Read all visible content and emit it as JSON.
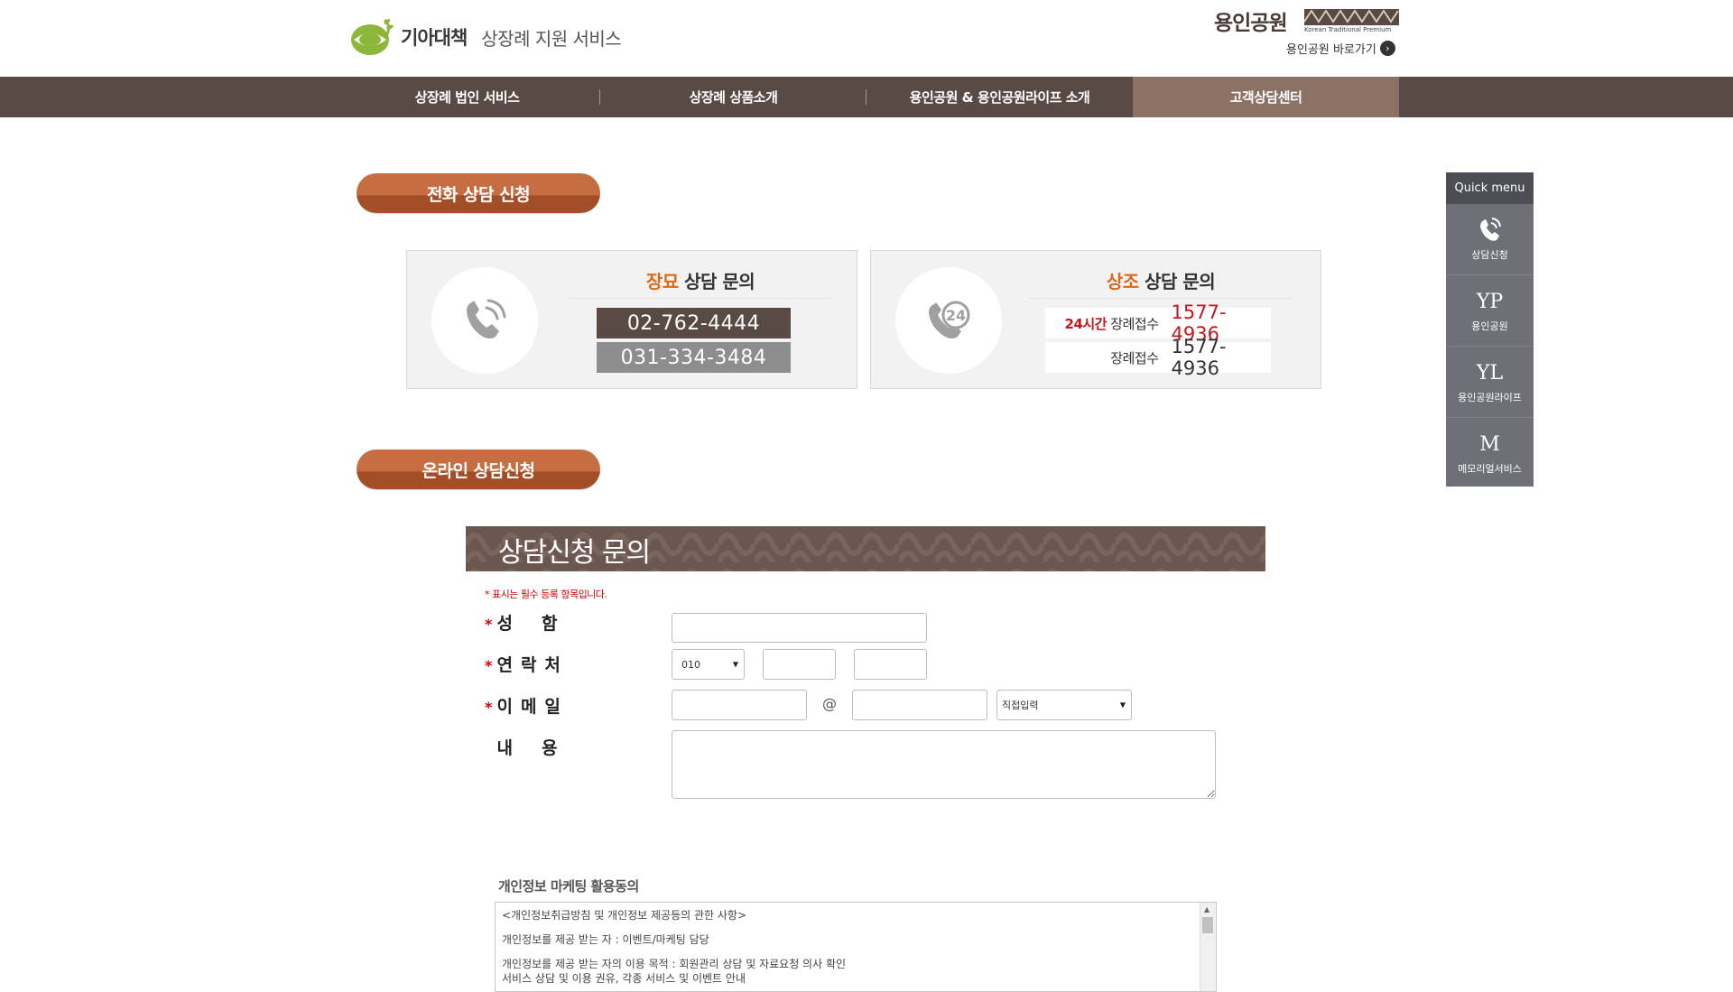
{
  "header": {
    "logo_bold": "기아대책",
    "logo_sub": "상장례 지원 서비스",
    "brand_title": "용인공원",
    "brand_sub": "Korean Traditional Premium",
    "brand_link": "용인공원 바로가기"
  },
  "nav": {
    "items": [
      {
        "label": "상장례 법인 서비스"
      },
      {
        "label": "상장례 상품소개"
      },
      {
        "label": "용인공원 & 용인공원라이프 소개"
      },
      {
        "label": "고객상담센터"
      }
    ]
  },
  "phone_section": {
    "heading": "전화 상담 신청",
    "left": {
      "title_hl": "장묘",
      "title_rest": " 상담 문의",
      "numbers": [
        "02-762-4444",
        "031-334-3484"
      ],
      "icon": "phone-icon"
    },
    "right": {
      "title_hl": "상조",
      "title_rest": " 상담 문의",
      "icon": "phone-24-icon",
      "rows": [
        {
          "label_red": "24시간",
          "label": "장례접수",
          "number": "1577-4936"
        },
        {
          "label_red": "",
          "label": "장례접수",
          "number": "1577-4936"
        }
      ]
    }
  },
  "online_section": {
    "heading": "온라인 상담신청",
    "banner_title": "상담신청 문의",
    "required_note": "* 표시는 필수 등록 항목입니다.",
    "fields": {
      "name_label": "성함",
      "phone_label": "연락처",
      "phone_prefix": "010",
      "email_label": "이메일",
      "email_at": "@",
      "email_domain_select": "직접입력",
      "content_label": "내용"
    },
    "privacy_title": "개인정보 마케팅 활용동의",
    "privacy_lines": [
      "<개인정보취급방침 및 개인정보 제공등의 관한 사항>",
      "개인정보를 제공 받는 자 : 이벤트/마케팅 담당",
      "개인정보를 제공 받는 자의 이용 목적 : 회원관리 상담 및 자료요청 의사 확인",
      "서비스 상담 및 이용 권유, 각종 서비스 및 이벤트 안내"
    ]
  },
  "quick_menu": {
    "title": "Quick menu",
    "items": [
      {
        "big": "",
        "label": "상담신청",
        "icon": "phone-icon"
      },
      {
        "big": "YP",
        "label": "용인공원"
      },
      {
        "big": "YL",
        "label": "용인공원라이프"
      },
      {
        "big": "M",
        "label": "메모리얼서비스"
      }
    ]
  },
  "colors": {
    "nav_bg": "#5a4a45",
    "nav_active": "#8c7165",
    "pill": "#c66e42",
    "highlight": "#d86a1a",
    "phone_dark": "#5a4a45",
    "phone_gray": "#8d8d8d",
    "number_red": "#c4161c",
    "quick_menu_bg": "#6e7077"
  }
}
